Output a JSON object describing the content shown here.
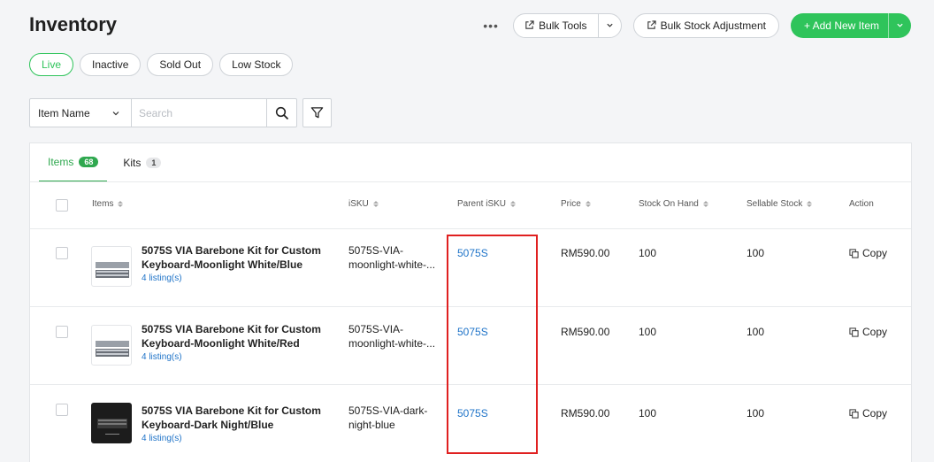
{
  "page": {
    "title": "Inventory"
  },
  "toolbar": {
    "more_label": "•••",
    "bulk_tools_label": "Bulk Tools",
    "bulk_adjustment_label": "Bulk Stock Adjustment",
    "add_item_label": "+ Add New Item"
  },
  "status_tabs": [
    "Live",
    "Inactive",
    "Sold Out",
    "Low Stock"
  ],
  "search": {
    "field": "Item Name",
    "placeholder": "Search"
  },
  "subtabs": [
    {
      "label": "Items",
      "count": "68"
    },
    {
      "label": "Kits",
      "count": "1"
    }
  ],
  "columns": {
    "items": "Items",
    "isku": "iSKU",
    "parent": "Parent iSKU",
    "price": "Price",
    "stock_on_hand": "Stock On Hand",
    "sellable": "Sellable Stock",
    "action": "Action"
  },
  "rows": [
    {
      "name": "5075S VIA Barebone Kit for Custom Keyboard-Moonlight White/Blue",
      "listing": "4 listing(s)",
      "isku": "5075S-VIA-moonlight-white-...",
      "parent": "5075S",
      "price": "RM590.00",
      "stock_on_hand": "100",
      "sellable": "100",
      "action": "Copy"
    },
    {
      "name": "5075S VIA Barebone Kit for Custom Keyboard-Moonlight White/Red",
      "listing": "4 listing(s)",
      "isku": "5075S-VIA-moonlight-white-...",
      "parent": "5075S",
      "price": "RM590.00",
      "stock_on_hand": "100",
      "sellable": "100",
      "action": "Copy"
    },
    {
      "name": "5075S VIA Barebone Kit for Custom Keyboard-Dark Night/Blue",
      "listing": "4 listing(s)",
      "isku": "5075S-VIA-dark-night-blue",
      "parent": "5075S",
      "price": "RM590.00",
      "stock_on_hand": "100",
      "sellable": "100",
      "action": "Copy"
    }
  ],
  "colors": {
    "accent_green": "#2fc45b",
    "link_blue": "#1e73c8",
    "highlight_red": "#e02020"
  }
}
